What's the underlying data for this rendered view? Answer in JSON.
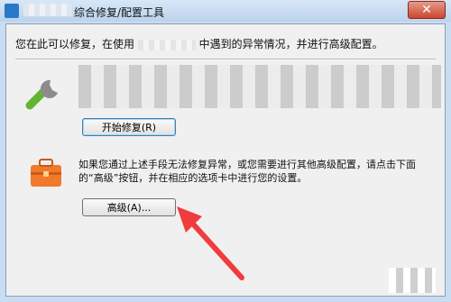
{
  "window": {
    "title": "综合修复/配置工具",
    "close_label": "✕"
  },
  "intro": {
    "prefix": "您在此可以修复，在使用",
    "suffix": "中遇到的异常情况，并进行高级配置。"
  },
  "repair": {
    "button_label": "开始修复(R)"
  },
  "advanced": {
    "description": "如果您通过上述手段无法修复异常，或您需要进行其他高级配置，请点击下面的“高级”按钮，并在相应的选项卡中进行您的设置。",
    "button_label": "高级(A)..."
  },
  "colors": {
    "annotation_arrow": "#f03c3c",
    "toolbox": "#f07a2a",
    "wrench_green": "#62b533"
  },
  "icons": [
    "app-icon",
    "wrench-icon",
    "toolbox-icon",
    "close-icon"
  ]
}
